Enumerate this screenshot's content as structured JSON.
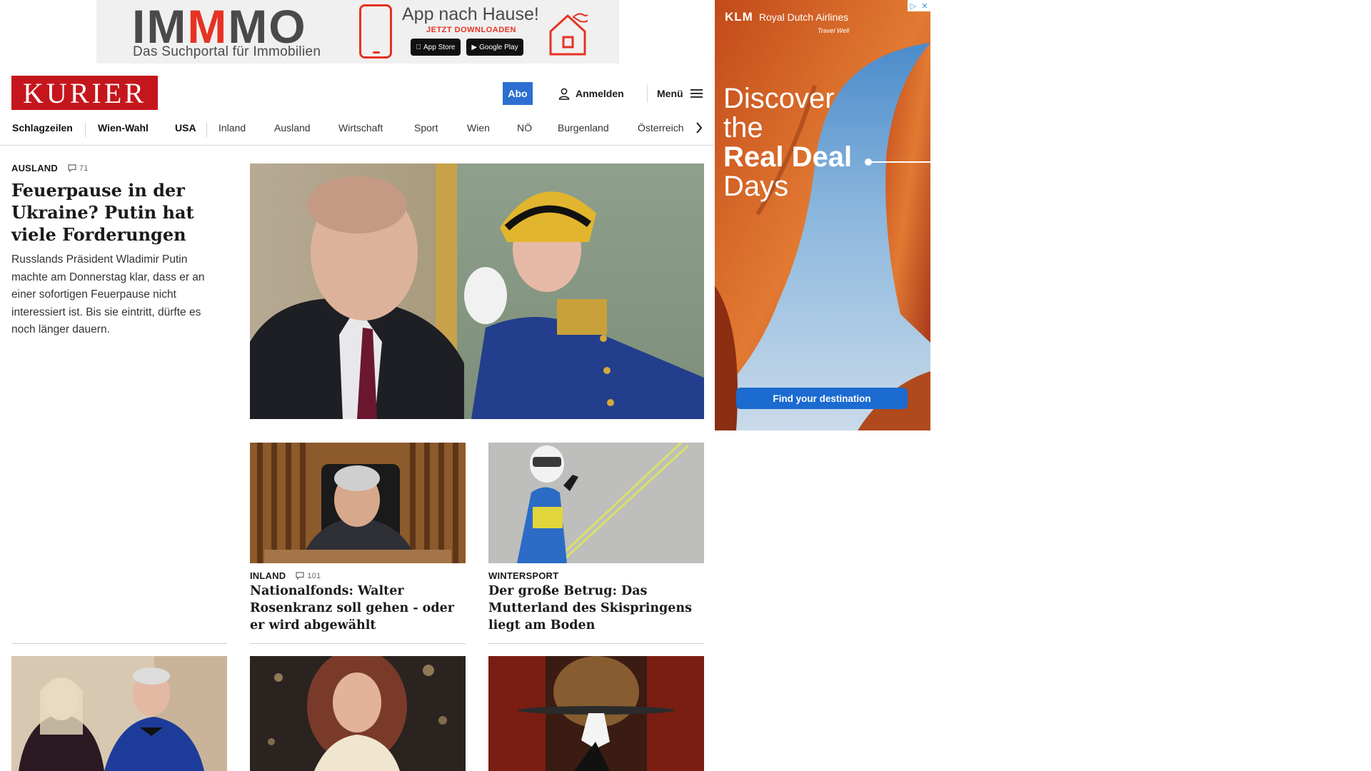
{
  "top_ad": {
    "logo_pre": "IM",
    "logo_accent": "M",
    "logo_post": "MO",
    "tagline": "Das Suchportal für Immobilien",
    "app_title": "App nach Hause!",
    "app_sub": "JETZT DOWNLOADEN",
    "apple_label": "App Store",
    "google_label": "Google Play"
  },
  "header": {
    "logo_text": "KURIER",
    "abo_label": "Abo",
    "login_label": "Anmelden",
    "menu_label": "Menü"
  },
  "nav": {
    "items": [
      "Schlagzeilen",
      "Wien-Wahl",
      "USA",
      "Inland",
      "Ausland",
      "Wirtschaft",
      "Sport",
      "Wien",
      "NÖ",
      "Burgenland",
      "Österreich"
    ]
  },
  "lead": {
    "category": "AUSLAND",
    "comments": "71",
    "title": "Feuerpause in der Ukraine? Putin hat viele Forderungen",
    "teaser": "Russlands Präsident Wladimir Putin machte am Donnerstag klar, dass er an einer sofortigen Feuerpause nicht interessiert ist. Bis sie eintritt, dürfte es noch länger dauern."
  },
  "articles": [
    {
      "category": "INLAND",
      "comments": "101",
      "title": "Nationalfonds: Walter Rosenkranz soll gehen - oder er wird abgewählt"
    },
    {
      "category": "WINTERSPORT",
      "title": "Der große Betrug: Das Mutterland des Skispringens liegt am Boden"
    }
  ],
  "side_ad": {
    "airline": "Royal Dutch Airlines",
    "logo": "KLM",
    "tag": "Travel Well",
    "line1": "Discover",
    "line2": "the",
    "line3": "Real Deal",
    "line4": "Days",
    "cta": "Find your destination"
  },
  "colors": {
    "brand_red": "#c5161d",
    "abo_blue": "#2d6fd1",
    "immo_red": "#e63223",
    "ad_cta_blue": "#1b6bd1"
  },
  "icons": [
    "user-icon",
    "hamburger-icon",
    "chevron-right-icon",
    "comment-icon",
    "apple-icon",
    "google-play-icon",
    "ad-choices-icon",
    "close-icon"
  ]
}
